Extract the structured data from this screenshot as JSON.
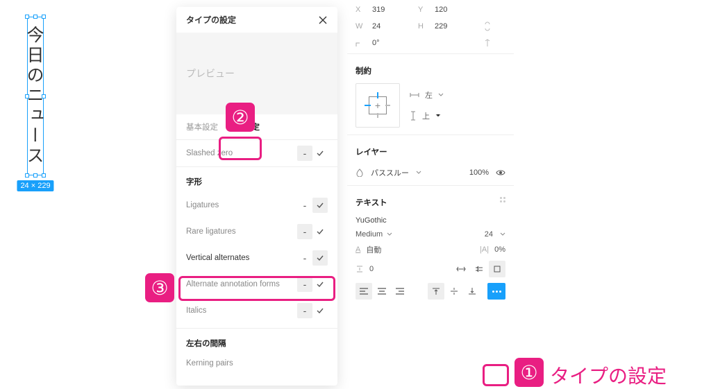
{
  "canvas": {
    "text": "今日のニュース",
    "dimensions": "24 × 229"
  },
  "typePanel": {
    "title": "タイプの設定",
    "preview_label": "プレビュー",
    "tabs": {
      "basic": "基本設定",
      "advanced": "詳細設定"
    },
    "rows": {
      "slashed_zero": "Slashed zero",
      "letterforms": "字形",
      "ligatures": "Ligatures",
      "rare_ligatures": "Rare ligatures",
      "vertical_alternates": "Vertical alternates",
      "alternate_annotation": "Alternate annotation forms",
      "italics": "Italics",
      "horizontal_spacing": "左右の間隔",
      "kerning_pairs": "Kerning pairs"
    }
  },
  "props": {
    "x_label": "X",
    "x_value": "319",
    "y_label": "Y",
    "y_value": "120",
    "w_label": "W",
    "w_value": "24",
    "h_label": "H",
    "h_value": "229",
    "rot_value": "0°",
    "constraints_title": "制約",
    "h_constraint": "左",
    "v_constraint": "上",
    "layer_title": "レイヤー",
    "blend_mode": "パススルー",
    "opacity": "100%",
    "text_title": "テキスト",
    "font_family": "YuGothic",
    "font_weight": "Medium",
    "font_size": "24",
    "line_height_label": "自動",
    "letter_spacing": "0%",
    "paragraph_spacing": "0"
  },
  "callouts": {
    "c1": "①",
    "c2": "②",
    "c3": "③",
    "c1_label": "タイプの設定"
  }
}
